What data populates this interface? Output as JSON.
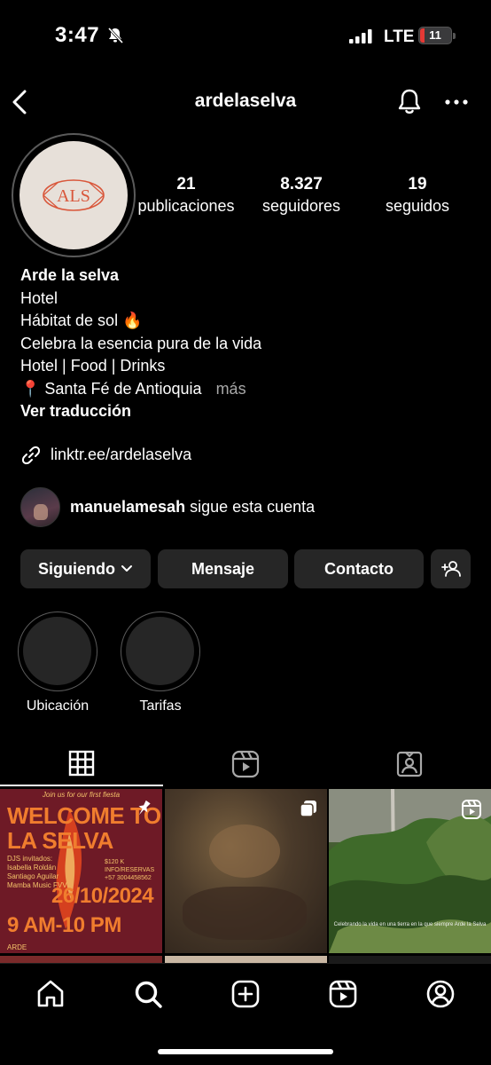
{
  "status_bar": {
    "time": "3:47",
    "network": "LTE",
    "battery": "11",
    "icons": [
      "bell-slash-icon",
      "signal-icon",
      "battery-icon"
    ]
  },
  "header": {
    "username": "ardelaselva",
    "icons": [
      "chevron-left-icon",
      "bell-icon",
      "more-icon"
    ]
  },
  "profile": {
    "avatar_monogram": "ALS",
    "stats": [
      {
        "value": "21",
        "label": "publicaciones"
      },
      {
        "value": "8.327",
        "label": "seguidores"
      },
      {
        "value": "19",
        "label": "seguidos"
      }
    ],
    "bio": {
      "name": "Arde la selva",
      "lines": [
        "Hotel",
        "Hábitat de sol 🔥",
        "Celebra la esencia pura de la vida",
        "Hotel | Food | Drinks",
        "📍 Santa Fé de Antioquia"
      ],
      "more": "más",
      "translate": "Ver traducción"
    },
    "link": "linktr.ee/ardelaselva",
    "followed_by": {
      "username": "manuelamesah",
      "text": "sigue esta cuenta"
    }
  },
  "actions": {
    "following": "Siguiendo",
    "message": "Mensaje",
    "contact": "Contacto"
  },
  "highlights": [
    {
      "label": "Ubicación"
    },
    {
      "label": "Tarifas"
    }
  ],
  "tabs": [
    "grid-icon",
    "reels-icon",
    "tagged-icon"
  ],
  "posts": {
    "post1": {
      "top": "Join us for our first fiesta",
      "headline": "WELCOME TO LA SELVA",
      "guests": "DJS invitados: Isabella Roldán Santiago Aguilar Mamba Music FVV",
      "info": "$120 K INFO/RESERVAS +57 3004458562",
      "date": "26/10/2024",
      "hours": "9 AM-10 PM",
      "footer": "ARDE"
    },
    "post3_caption": "Celebrando la vida en una tierra en la que siempre Arde la Selva"
  },
  "bottom_nav": [
    "home-icon",
    "search-icon",
    "create-icon",
    "reels-icon",
    "profile-icon"
  ],
  "colors": {
    "background": "#000000",
    "button": "#262626",
    "muted": "#a8a8a8",
    "brand_red": "#d9573b",
    "avatar_bg": "#e7e0d9"
  }
}
